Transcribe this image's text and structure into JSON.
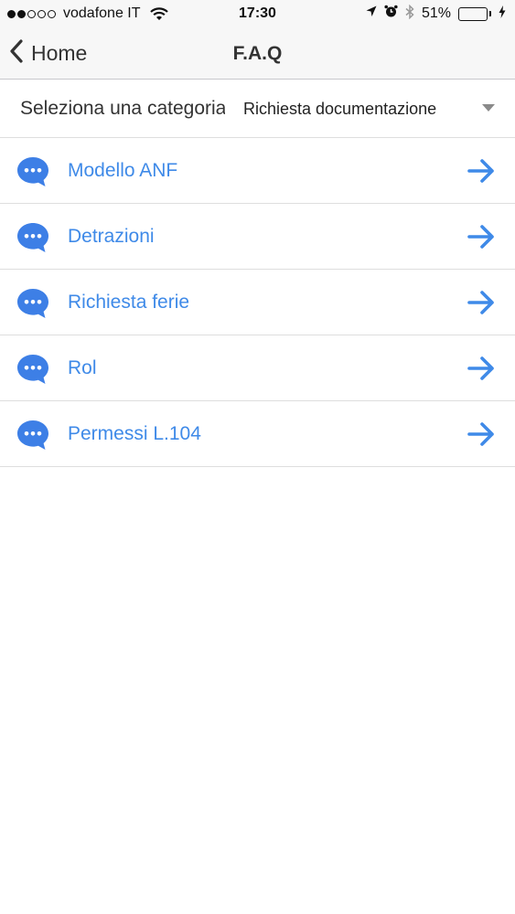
{
  "status_bar": {
    "signal_filled": 2,
    "signal_empty": 3,
    "carrier": "vodafone IT",
    "time": "17:30",
    "battery_percent_text": "51%",
    "battery_level": 0.51,
    "icons": [
      "wifi-icon",
      "location-arrow-icon",
      "alarm-clock-icon",
      "bluetooth-icon",
      "battery-icon",
      "charging-bolt-icon"
    ]
  },
  "nav": {
    "back_label": "Home",
    "title": "F.A.Q"
  },
  "selector": {
    "label": "Seleziona una categoria",
    "value": "Richiesta documentazione"
  },
  "faq_items": [
    {
      "label": "Modello ANF"
    },
    {
      "label": "Detrazioni"
    },
    {
      "label": "Richiesta ferie"
    },
    {
      "label": "Rol"
    },
    {
      "label": "Permessi L.104"
    }
  ],
  "colors": {
    "accent": "#3f8ae8",
    "bubble": "#3d7fe6",
    "battery_fill": "#4cd964"
  }
}
